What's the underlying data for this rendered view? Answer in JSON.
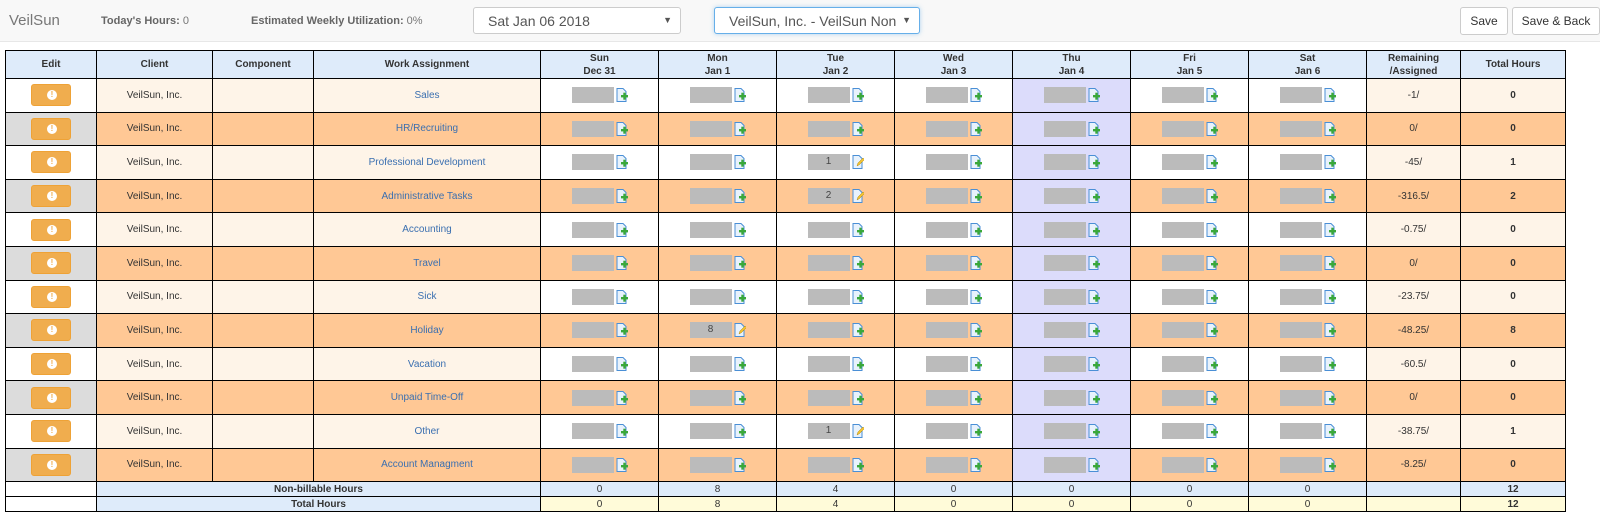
{
  "topbar": {
    "brand": "VeilSun",
    "todays_hours_label": "Today's Hours:",
    "todays_hours_value": "0",
    "utilization_label": "Estimated Weekly Utilization:",
    "utilization_value": "0%",
    "date_select": "Sat Jan 06 2018",
    "client_select": "VeilSun, Inc. - VeilSun Non-B",
    "save_label": "Save",
    "save_back_label": "Save & Back"
  },
  "colors": {
    "edit_button": "#f0ad4e",
    "header_bg": "#deebfa",
    "row_alt": "#ffc895",
    "row_light": "#fef4e8",
    "today_col": "#dcdcfb",
    "link": "#3a6fb0",
    "total_row": "#fffbd9"
  },
  "table": {
    "headers": {
      "edit": "Edit",
      "client": "Client",
      "component": "Component",
      "work_assignment": "Work Assignment",
      "days": [
        {
          "dow": "Sun",
          "date": "Dec 31"
        },
        {
          "dow": "Mon",
          "date": "Jan 1"
        },
        {
          "dow": "Tue",
          "date": "Jan 2"
        },
        {
          "dow": "Wed",
          "date": "Jan 3"
        },
        {
          "dow": "Thu",
          "date": "Jan 4"
        },
        {
          "dow": "Fri",
          "date": "Jan 5"
        },
        {
          "dow": "Sat",
          "date": "Jan 6"
        }
      ],
      "remaining_1": "Remaining",
      "remaining_2": "/Assigned",
      "total": "Total Hours"
    },
    "rows": [
      {
        "client": "VeilSun, Inc.",
        "component": "",
        "assignment": "Sales",
        "hours": [
          "",
          "",
          "",
          "",
          "",
          "",
          ""
        ],
        "remaining": "-1/",
        "total": "0"
      },
      {
        "client": "VeilSun, Inc.",
        "component": "",
        "assignment": "HR/Recruiting",
        "hours": [
          "",
          "",
          "",
          "",
          "",
          "",
          ""
        ],
        "remaining": "0/",
        "total": "0"
      },
      {
        "client": "VeilSun, Inc.",
        "component": "",
        "assignment": "Professional Development",
        "hours": [
          "",
          "",
          "1",
          "",
          "",
          "",
          ""
        ],
        "remaining": "-45/",
        "total": "1"
      },
      {
        "client": "VeilSun, Inc.",
        "component": "",
        "assignment": "Administrative Tasks",
        "hours": [
          "",
          "",
          "2",
          "",
          "",
          "",
          ""
        ],
        "remaining": "-316.5/",
        "total": "2"
      },
      {
        "client": "VeilSun, Inc.",
        "component": "",
        "assignment": "Accounting",
        "hours": [
          "",
          "",
          "",
          "",
          "",
          "",
          ""
        ],
        "remaining": "-0.75/",
        "total": "0"
      },
      {
        "client": "VeilSun, Inc.",
        "component": "",
        "assignment": "Travel",
        "hours": [
          "",
          "",
          "",
          "",
          "",
          "",
          ""
        ],
        "remaining": "0/",
        "total": "0"
      },
      {
        "client": "VeilSun, Inc.",
        "component": "",
        "assignment": "Sick",
        "hours": [
          "",
          "",
          "",
          "",
          "",
          "",
          ""
        ],
        "remaining": "-23.75/",
        "total": "0"
      },
      {
        "client": "VeilSun, Inc.",
        "component": "",
        "assignment": "Holiday",
        "hours": [
          "",
          "8",
          "",
          "",
          "",
          "",
          ""
        ],
        "remaining": "-48.25/",
        "total": "8"
      },
      {
        "client": "VeilSun, Inc.",
        "component": "",
        "assignment": "Vacation",
        "hours": [
          "",
          "",
          "",
          "",
          "",
          "",
          ""
        ],
        "remaining": "-60.5/",
        "total": "0"
      },
      {
        "client": "VeilSun, Inc.",
        "component": "",
        "assignment": "Unpaid Time-Off",
        "hours": [
          "",
          "",
          "",
          "",
          "",
          "",
          ""
        ],
        "remaining": "0/",
        "total": "0"
      },
      {
        "client": "VeilSun, Inc.",
        "component": "",
        "assignment": "Other",
        "hours": [
          "",
          "",
          "1",
          "",
          "",
          "",
          ""
        ],
        "remaining": "-38.75/",
        "total": "1"
      },
      {
        "client": "VeilSun, Inc.",
        "component": "",
        "assignment": "Account Managment",
        "hours": [
          "",
          "",
          "",
          "",
          "",
          "",
          ""
        ],
        "remaining": "-8.25/",
        "total": "0"
      }
    ],
    "non_billable": {
      "label": "Non-billable Hours",
      "days": [
        "0",
        "8",
        "4",
        "0",
        "0",
        "0",
        "0"
      ],
      "remaining": "",
      "total": "12"
    },
    "total_hours": {
      "label": "Total Hours",
      "days": [
        "0",
        "8",
        "4",
        "0",
        "0",
        "0",
        "0"
      ],
      "remaining": "",
      "total": "12"
    }
  }
}
